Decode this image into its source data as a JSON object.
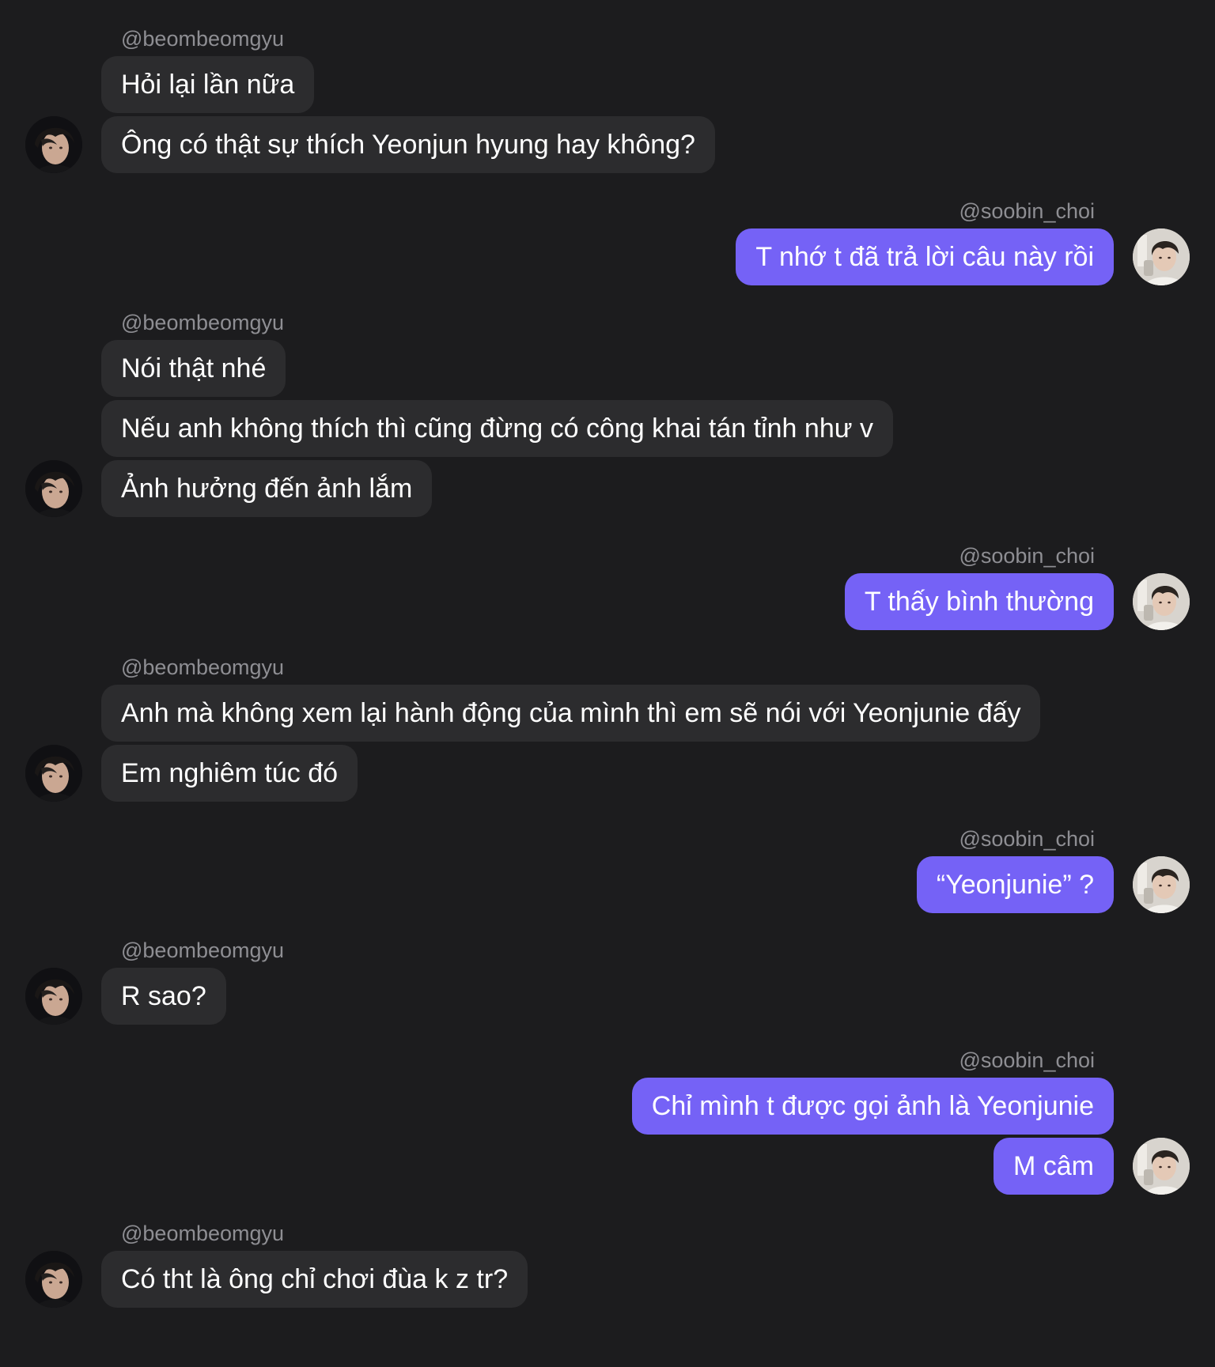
{
  "conversation": {
    "groups": [
      {
        "side": "in",
        "username": "@beombeomgyu",
        "avatar_icon": "profile-photo-dark-hair-icon",
        "messages": [
          "Hỏi lại lần nữa",
          "Ông có thật sự thích Yeonjun hyung hay không?"
        ]
      },
      {
        "side": "out",
        "username": "@soobin_choi",
        "avatar_icon": "profile-photo-light-icon",
        "messages": [
          "T nhớ t đã trả lời câu này rồi"
        ]
      },
      {
        "side": "in",
        "username": "@beombeomgyu",
        "avatar_icon": "profile-photo-dark-hair-icon",
        "messages": [
          "Nói thật nhé",
          "Nếu anh không thích thì cũng đừng có công khai tán tỉnh như v",
          "Ảnh hưởng đến ảnh lắm"
        ]
      },
      {
        "side": "out",
        "username": "@soobin_choi",
        "avatar_icon": "profile-photo-light-icon",
        "messages": [
          "T thấy bình thường"
        ]
      },
      {
        "side": "in",
        "username": "@beombeomgyu",
        "avatar_icon": "profile-photo-dark-hair-icon",
        "messages": [
          "Anh mà không xem lại hành động của mình thì em sẽ nói với Yeonjunie đấy",
          "Em nghiêm túc đó"
        ]
      },
      {
        "side": "out",
        "username": "@soobin_choi",
        "avatar_icon": "profile-photo-light-icon",
        "messages": [
          "“Yeonjunie” ?"
        ]
      },
      {
        "side": "in",
        "username": "@beombeomgyu",
        "avatar_icon": "profile-photo-dark-hair-icon",
        "messages": [
          "R sao?"
        ]
      },
      {
        "side": "out",
        "username": "@soobin_choi",
        "avatar_icon": "profile-photo-light-icon",
        "messages": [
          "Chỉ mình t được gọi ảnh là Yeonjunie",
          "M câm"
        ]
      },
      {
        "side": "in",
        "username": "@beombeomgyu",
        "avatar_icon": "profile-photo-dark-hair-icon",
        "messages": [
          "Có tht là ông chỉ chơi đùa k z tr?"
        ]
      }
    ]
  },
  "colors": {
    "background": "#1c1c1e",
    "incoming_bubble": "#2c2c2e",
    "outgoing_bubble": "#7562f6",
    "username_text": "#8e8e93",
    "message_text": "#ffffff"
  }
}
